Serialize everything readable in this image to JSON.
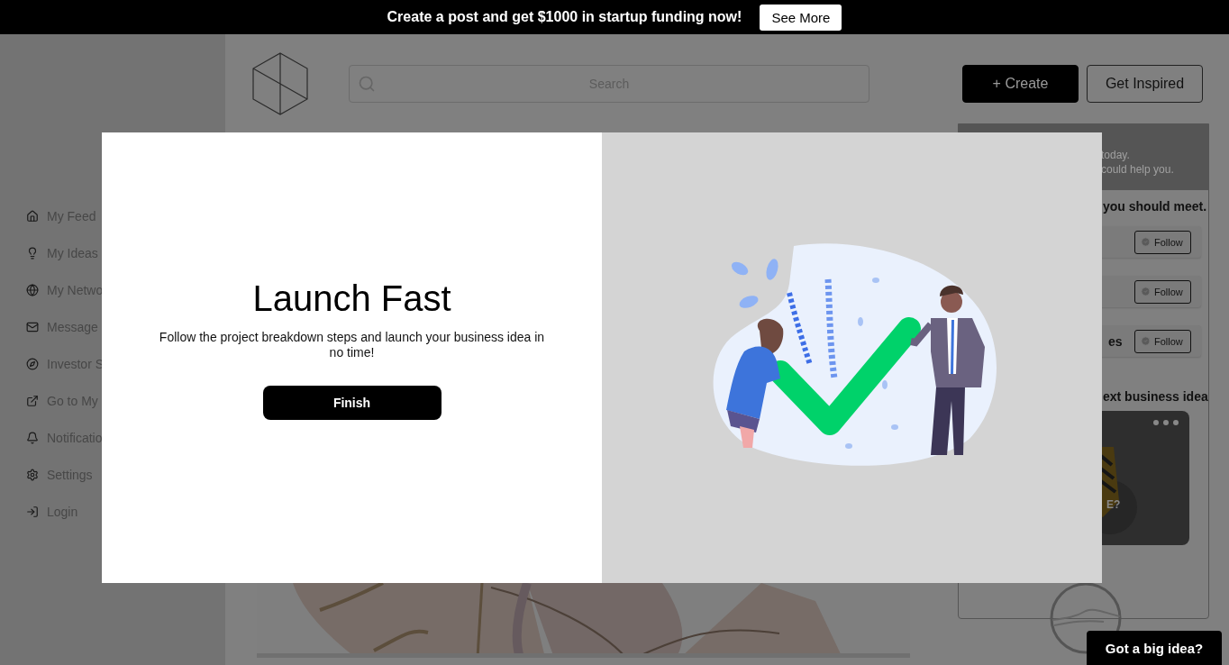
{
  "banner": {
    "message": "Create a post and get $1000 in startup funding now!",
    "button": "See More"
  },
  "sidebar": {
    "items": [
      {
        "label": "My Feed"
      },
      {
        "label": "My Ideas"
      },
      {
        "label": "My Netwo"
      },
      {
        "label": "Message"
      },
      {
        "label": "Investor S"
      },
      {
        "label": "Go to My"
      },
      {
        "label": "Notificatio"
      },
      {
        "label": "Settings"
      },
      {
        "label": "Login"
      }
    ]
  },
  "header": {
    "search_placeholder": "Search",
    "buttons": [
      {
        "kind": "primary",
        "label": "+ Create"
      },
      {
        "kind": "outline",
        "label": "Get Inspired"
      }
    ]
  },
  "right_panel": {
    "intro_lines": [
      "today.",
      "could help you."
    ],
    "people_heading": "you should meet.",
    "people": [
      {
        "follow": "Follow"
      },
      {
        "follow": "Follow"
      },
      {
        "name": "es",
        "follow": "Follow"
      }
    ],
    "ideas_heading": "ext business idea",
    "idea_card": {
      "caption": "E?"
    }
  },
  "modal": {
    "title": "Launch Fast",
    "text": "Follow the project breakdown steps and launch your business idea in no time!",
    "button": "Finish"
  },
  "chat_button": "Got a big idea?"
}
